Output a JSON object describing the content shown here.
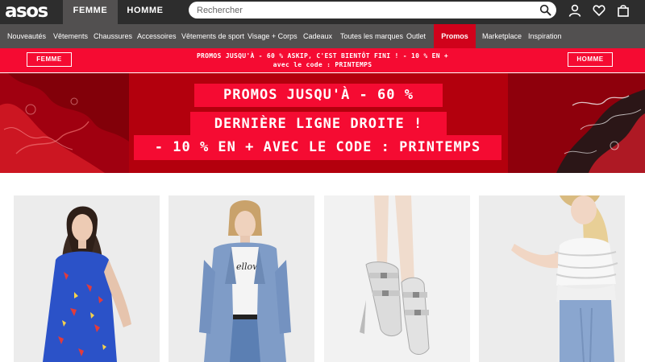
{
  "header": {
    "logo": "asos",
    "gender_tabs": [
      {
        "label": "FEMME",
        "active": true
      },
      {
        "label": "HOMME",
        "active": false
      }
    ],
    "search": {
      "placeholder": "Rechercher",
      "value": ""
    },
    "icons": [
      "search-icon",
      "user-icon",
      "heart-icon",
      "bag-icon"
    ]
  },
  "nav": {
    "items": [
      "Nouveautés",
      "Vêtements",
      "Chaussures",
      "Accessoires",
      "Vêtements de sport",
      "Visage + Corps",
      "Cadeaux",
      "Toutes les marques",
      "Outlet",
      "Promos",
      "Marketplace",
      "Inspiration"
    ],
    "highlight": "Promos"
  },
  "promo_strip": {
    "left_button": "FEMME",
    "right_button": "HOMME",
    "line1": "PROMOS JUSQU'À - 60 % ASKIP, C'EST BIENTÔT FINI ! - 10 % EN +",
    "line2": "avec le code : PRINTEMPS"
  },
  "hero": {
    "line1": "PROMOS JUSQU'À - 60 %",
    "line2": "DERNIÈRE LIGNE DROITE !",
    "line3": "- 10 % EN + AVEC LE CODE : PRINTEMPS"
  },
  "products": [
    {
      "name": "product-floral-dress"
    },
    {
      "name": "product-denim-jacket"
    },
    {
      "name": "product-silver-heels"
    },
    {
      "name": "product-ruffle-top"
    }
  ],
  "colors": {
    "topbar": "#2d2d2d",
    "nav": "#525050",
    "promo_red": "#f50b32",
    "hero_red": "#b3000d",
    "promos_tab": "#d0021b"
  }
}
